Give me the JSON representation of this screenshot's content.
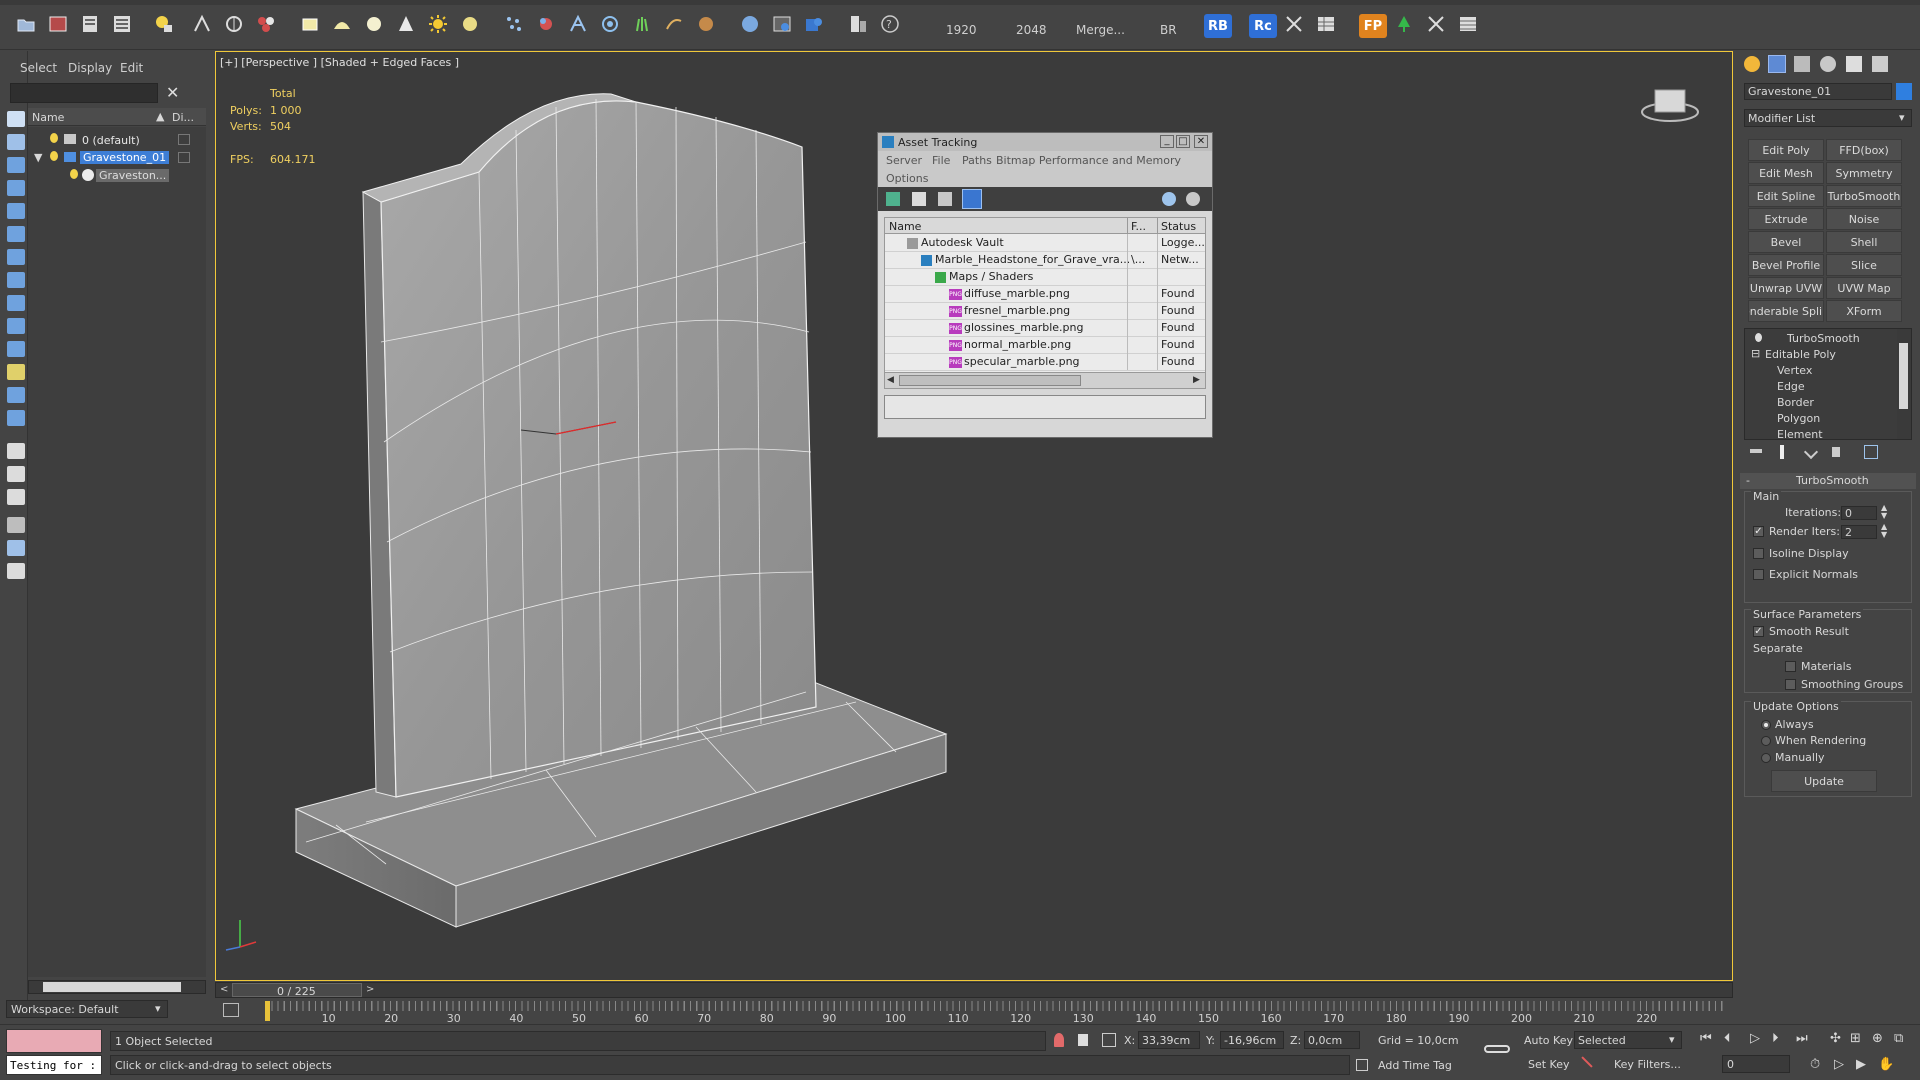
{
  "toolbar": {
    "values": [
      "1920",
      "2048",
      "Merge...",
      "BR"
    ],
    "badges": [
      {
        "label": "RB",
        "color": "#2f6fd6"
      },
      {
        "label": "Rc",
        "color": "#2f6fd6"
      },
      {
        "label": "FP",
        "color": "#e0831e"
      }
    ]
  },
  "scene_explorer": {
    "tabs": [
      "Select",
      "Display",
      "Edit"
    ],
    "columns": [
      "Name",
      "Di..."
    ],
    "items": [
      {
        "label": "0 (default)"
      },
      {
        "label": "Gravestone_01"
      },
      {
        "label": "Graveston..."
      }
    ],
    "workspace": "Workspace: Default"
  },
  "viewport": {
    "label": "[+] [Perspective ] [Shaded + Edged Faces ]",
    "stats": {
      "total_label": "Total",
      "polys_label": "Polys:",
      "polys_value": "1 000",
      "verts_label": "Verts:",
      "verts_value": "504",
      "fps_label": "FPS:",
      "fps_value": "604.171"
    }
  },
  "asset_tracking": {
    "title": "Asset Tracking",
    "menu": [
      "Server",
      "File",
      "Paths",
      "Bitmap Performance and Memory",
      "Options"
    ],
    "columns": [
      "Name",
      "F...",
      "Status"
    ],
    "rows": [
      {
        "name": "Autodesk Vault",
        "f": "",
        "status": "Logge...",
        "indent": 1,
        "icon": "vault-icon"
      },
      {
        "name": "Marble_Headstone_for_Grave_vra...",
        "f": "\\...",
        "status": "Netw...",
        "indent": 2,
        "icon": "max-file-icon"
      },
      {
        "name": "Maps / Shaders",
        "f": "",
        "status": "",
        "indent": 3,
        "icon": "maps-icon"
      },
      {
        "name": "diffuse_marble.png",
        "f": "",
        "status": "Found",
        "indent": 4,
        "icon": "png-icon"
      },
      {
        "name": "fresnel_marble.png",
        "f": "",
        "status": "Found",
        "indent": 4,
        "icon": "png-icon"
      },
      {
        "name": "glossines_marble.png",
        "f": "",
        "status": "Found",
        "indent": 4,
        "icon": "png-icon"
      },
      {
        "name": "normal_marble.png",
        "f": "",
        "status": "Found",
        "indent": 4,
        "icon": "png-icon"
      },
      {
        "name": "specular_marble.png",
        "f": "",
        "status": "Found",
        "indent": 4,
        "icon": "png-icon"
      }
    ],
    "png_tag": "PNG"
  },
  "command_panel": {
    "object_name": "Gravestone_01",
    "modifier_list": "Modifier List",
    "buttons": [
      [
        "Edit Poly",
        "FFD(box)"
      ],
      [
        "Edit Mesh",
        "Symmetry"
      ],
      [
        "Edit Spline",
        "TurboSmooth"
      ],
      [
        "Extrude",
        "Noise"
      ],
      [
        "Bevel",
        "Shell"
      ],
      [
        "Bevel Profile",
        "Slice"
      ],
      [
        "Unwrap UVW",
        "UVW Map"
      ],
      [
        "enderable Splin",
        "XForm"
      ]
    ],
    "stack": [
      "TurboSmooth",
      "Editable Poly",
      "Vertex",
      "Edge",
      "Border",
      "Polygon",
      "Element"
    ],
    "rollout": {
      "title": "TurboSmooth",
      "main": "Main",
      "iterations_label": "Iterations:",
      "iterations_value": "0",
      "render_iters_label": "Render Iters:",
      "render_iters_value": "2",
      "isoline": "Isoline Display",
      "explicit_normals": "Explicit Normals",
      "surface": "Surface Parameters",
      "smooth_result": "Smooth Result",
      "separate": "Separate",
      "materials": "Materials",
      "smoothing_groups": "Smoothing Groups",
      "update_options": "Update Options",
      "always": "Always",
      "when_rendering": "When Rendering",
      "manually": "Manually",
      "update_btn": "Update"
    }
  },
  "timeline": {
    "frame_label": "0 / 225",
    "ticks": [
      "10",
      "20",
      "30",
      "40",
      "50",
      "60",
      "70",
      "80",
      "90",
      "100",
      "110",
      "120",
      "130",
      "140",
      "150",
      "160",
      "170",
      "180",
      "190",
      "200",
      "210",
      "220"
    ]
  },
  "status": {
    "maxscript": "Testing for :",
    "selected": "1 Object Selected",
    "prompt": "Click or click-and-drag to select objects",
    "x_label": "X:",
    "x_value": "33,39cm",
    "y_label": "Y:",
    "y_value": "-16,96cm",
    "z_label": "Z:",
    "z_value": "0,0cm",
    "grid": "Grid = 10,0cm",
    "add_time_tag": "Add Time Tag",
    "auto_key": "Auto Key",
    "set_key": "Set Key",
    "key_mode": "Selected",
    "key_filters": "Key Filters...",
    "frame": "0"
  }
}
